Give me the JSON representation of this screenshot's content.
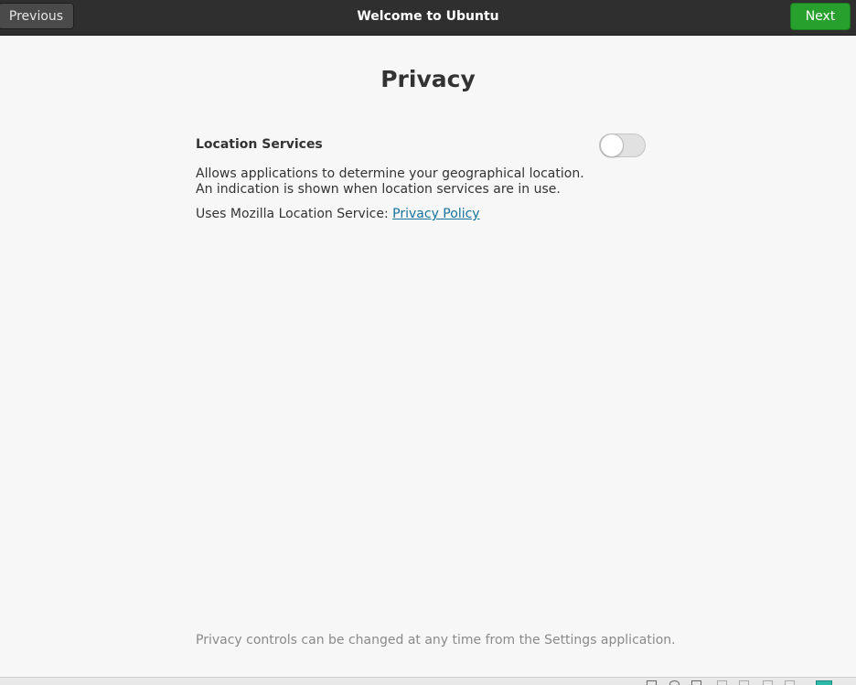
{
  "header": {
    "title": "Welcome to Ubuntu",
    "previous_label": "Previous",
    "next_label": "Next"
  },
  "page": {
    "title": "Privacy",
    "location_services": {
      "label": "Location Services",
      "enabled": false,
      "description": "Allows applications to determine your geographical location. An indication is shown when location services are in use.",
      "uses_prefix": "Uses Mozilla Location Service: ",
      "policy_link": "Privacy Policy"
    },
    "footer_note": "Privacy controls can be changed at any time from the Settings application."
  },
  "colors": {
    "next_button": "#28a02d",
    "header_bar": "#2f2f2f",
    "link": "#15739e"
  }
}
